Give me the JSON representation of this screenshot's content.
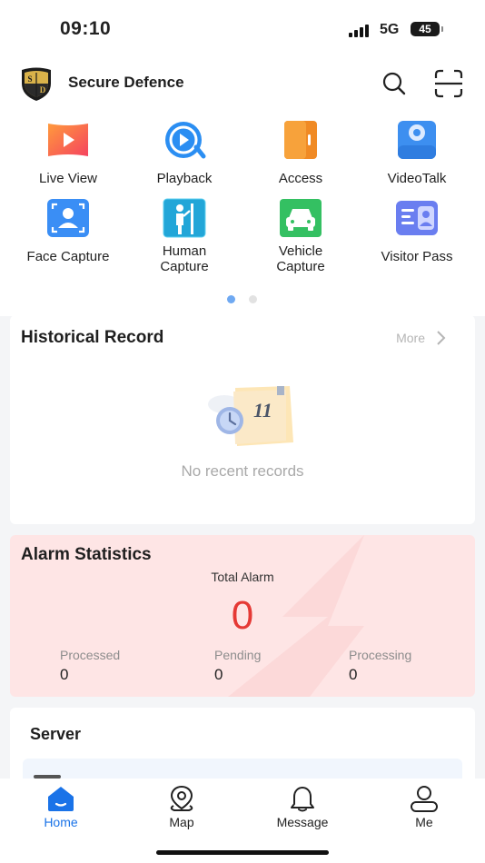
{
  "status": {
    "time": "09:10",
    "network": "5G",
    "battery": "45"
  },
  "header": {
    "title": "Secure Defence",
    "logo_letters": "S D"
  },
  "quick_access": [
    {
      "label": "Live View",
      "icon": "live-view-icon"
    },
    {
      "label": "Playback",
      "icon": "playback-icon"
    },
    {
      "label": "Access",
      "icon": "access-icon"
    },
    {
      "label": "VideoTalk",
      "icon": "videotalk-icon"
    },
    {
      "label": "Face Capture",
      "icon": "face-capture-icon"
    },
    {
      "label": "Human\nCapture",
      "icon": "human-capture-icon"
    },
    {
      "label": "Vehicle\nCapture",
      "icon": "vehicle-capture-icon"
    },
    {
      "label": "Visitor Pass",
      "icon": "visitor-pass-icon"
    }
  ],
  "pager": {
    "pages": 2,
    "active": 1
  },
  "historical": {
    "title": "Historical Record",
    "more": "More",
    "empty_text": "No recent records",
    "calendar_number": "11"
  },
  "alarm": {
    "title": "Alarm Statistics",
    "total_label": "Total Alarm",
    "total_value": "0",
    "stats": [
      {
        "label": "Processed",
        "value": "0"
      },
      {
        "label": "Pending",
        "value": "0"
      },
      {
        "label": "Processing",
        "value": "0"
      }
    ]
  },
  "server": {
    "title": "Server"
  },
  "tabs": [
    {
      "label": "Home",
      "active": true
    },
    {
      "label": "Map",
      "active": false
    },
    {
      "label": "Message",
      "active": false
    },
    {
      "label": "Me",
      "active": false
    }
  ],
  "colors": {
    "accent": "#1a73e8",
    "alarm_bg": "#fee5e5",
    "alarm_value": "#e53935"
  }
}
